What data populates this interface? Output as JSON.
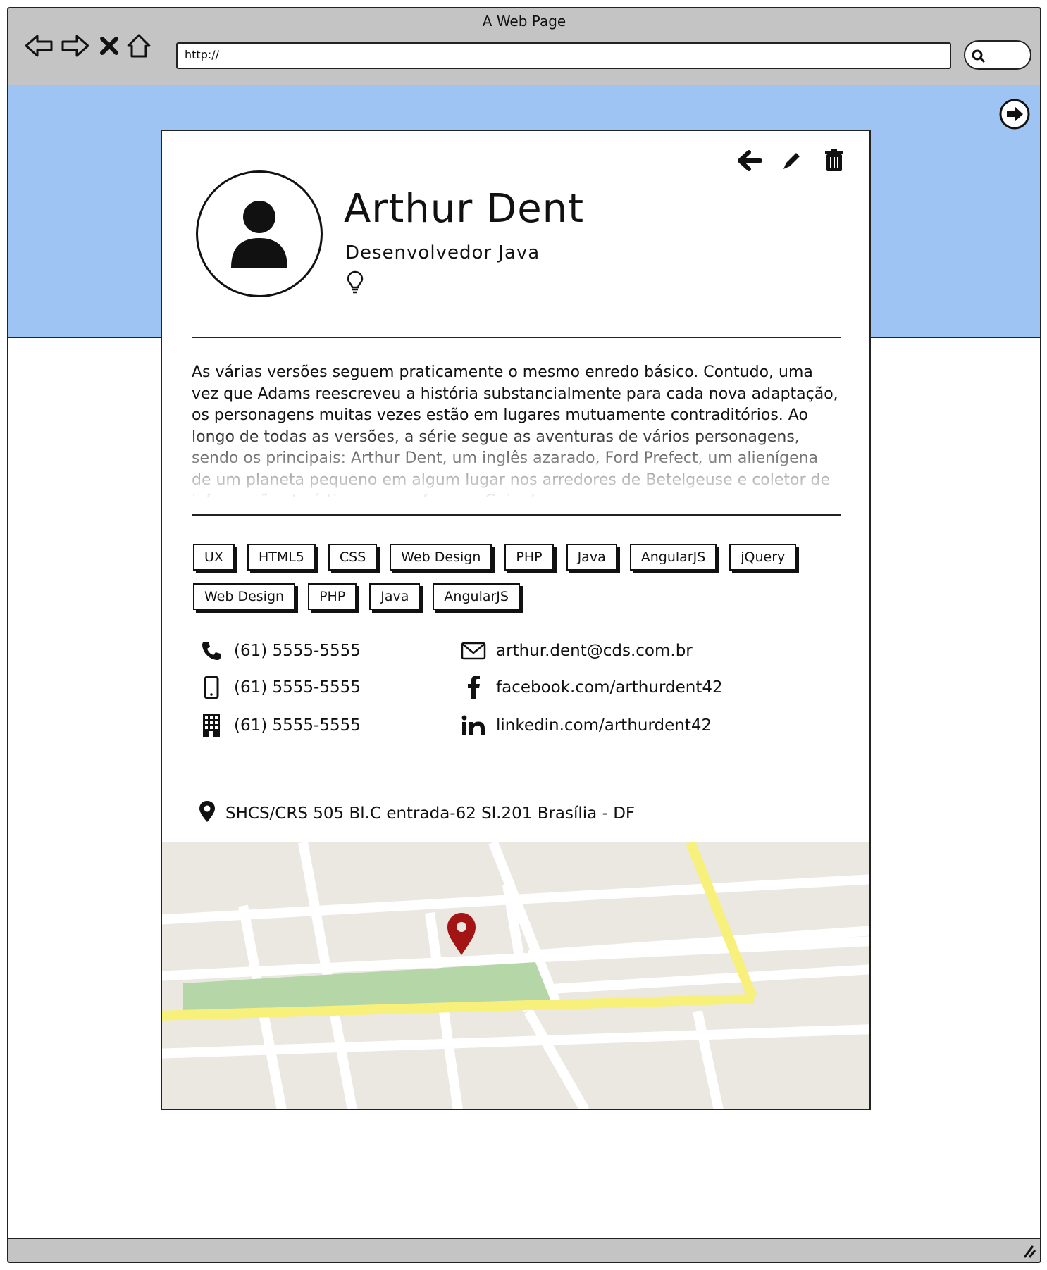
{
  "window": {
    "title": "A Web Page",
    "url": "http://"
  },
  "nav": [
    "back-icon",
    "forward-icon",
    "close-icon",
    "home-icon"
  ],
  "profile": {
    "name": "Arthur Dent",
    "role": "Desenvolvedor Java",
    "bio": "As várias versões seguem praticamente o mesmo enredo básico. Contudo, uma vez que Adams reescreveu a história substancialmente para cada nova adaptação, os personagens muitas vezes estão em lugares mutuamente contraditórios. Ao longo de todas as versões, a série segue as aventuras de vários personagens, sendo os principais: Arthur Dent, um inglês azarado, Ford Prefect, um alienígena de um planeta pequeno em algum lugar nos arredores de Betelgeuse e coletor de informações turísticas para o famoso Guia do..."
  },
  "tags": [
    "UX",
    "HTML5",
    "CSS",
    "Web Design",
    "PHP",
    "Java",
    "AngularJS",
    "jQuery",
    "Web Design",
    "PHP",
    "Java",
    "AngularJS"
  ],
  "contacts": {
    "phone": "(61) 5555-5555",
    "mobile": "(61) 5555-5555",
    "office": "(61) 5555-5555",
    "email": "arthur.dent@cds.com.br",
    "facebook": "facebook.com/arthurdent42",
    "linkedin": "linkedin.com/arthurdent42"
  },
  "address": "SHCS/CRS 505 Bl.C entrada-62 Sl.201  Brasília - DF",
  "colors": {
    "hero": "#9ec4f4",
    "chrome": "#c4c4c4",
    "map_pin": "#a31515",
    "map_park": "#b5d6a7",
    "map_road_major": "#f7f07a"
  }
}
